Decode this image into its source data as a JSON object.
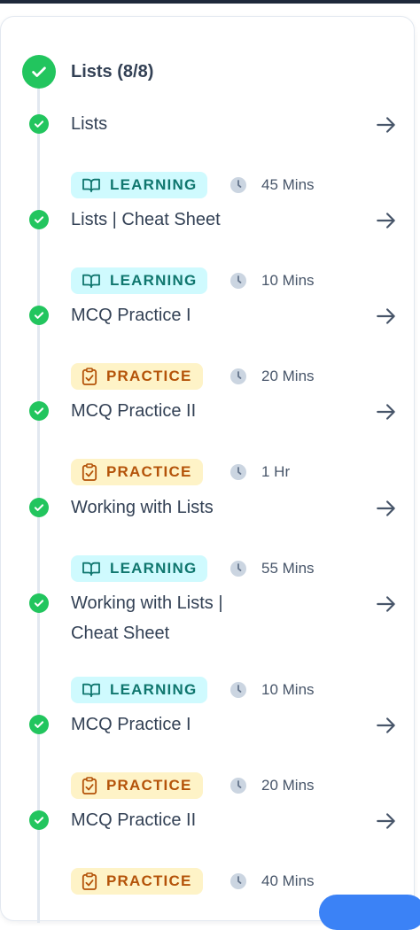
{
  "module": {
    "title": "Lists (8/8)"
  },
  "items": [
    {
      "title": "Lists",
      "type": "LEARNING",
      "duration": "45 Mins"
    },
    {
      "title": "Lists | Cheat Sheet",
      "type": "LEARNING",
      "duration": "10 Mins"
    },
    {
      "title": "MCQ Practice I",
      "type": "PRACTICE",
      "duration": "20 Mins"
    },
    {
      "title": "MCQ Practice II",
      "type": "PRACTICE",
      "duration": "1 Hr"
    },
    {
      "title": "Working with Lists",
      "type": "LEARNING",
      "duration": "55 Mins"
    },
    {
      "title": "Working with Lists | Cheat Sheet",
      "type": "LEARNING",
      "duration": "10 Mins"
    },
    {
      "title": "MCQ Practice I",
      "type": "PRACTICE",
      "duration": "20 Mins"
    },
    {
      "title": "MCQ Practice II",
      "type": "PRACTICE",
      "duration": "40 Mins"
    }
  ],
  "colors": {
    "complete": "#22c55e",
    "learning_bg": "#cffafe",
    "learning_fg": "#0f766e",
    "practice_bg": "#fef3c7",
    "practice_fg": "#b45309",
    "help_button": "#3b82f6"
  },
  "icons": {
    "header": "check-circle-icon",
    "item_status": "check-circle-icon",
    "learning": "book-open-icon",
    "practice": "clipboard-check-icon",
    "duration": "clock-icon",
    "open": "arrow-right-icon"
  }
}
